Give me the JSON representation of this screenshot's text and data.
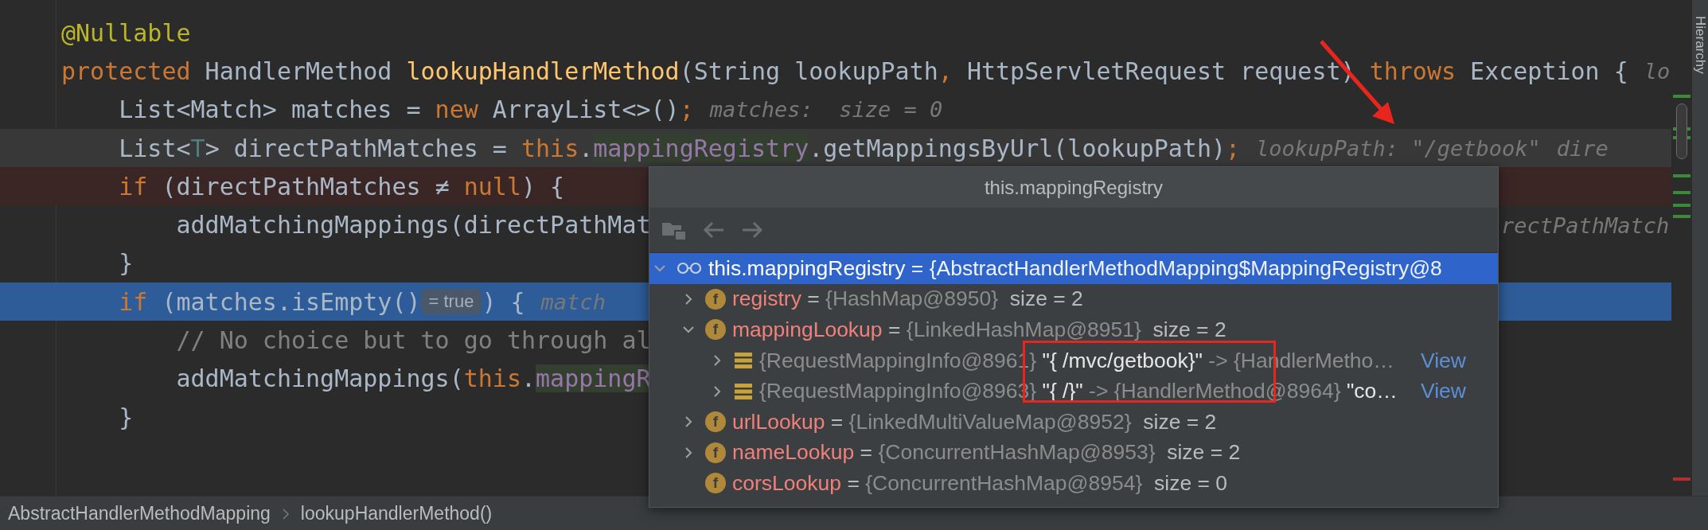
{
  "code_lines": [
    {
      "current_line": false,
      "breakpoint": false,
      "execution_point": false,
      "segments": [
        {
          "text": "@Nullable",
          "kind": "annotation"
        }
      ]
    },
    {
      "current_line": false,
      "breakpoint": false,
      "execution_point": false,
      "segments": [
        {
          "text": "protected",
          "kind": "keyword"
        },
        {
          "text": " HandlerMethod ",
          "kind": "plain"
        },
        {
          "text": "lookupHandlerMethod",
          "kind": "method"
        },
        {
          "text": "(String lookupPath",
          "kind": "plain"
        },
        {
          "text": ",",
          "kind": "keyword"
        },
        {
          "text": " HttpServletRequest request) ",
          "kind": "plain"
        },
        {
          "text": "throws",
          "kind": "keyword"
        },
        {
          "text": " Exception {",
          "kind": "plain"
        },
        {
          "text": "lo",
          "kind": "hint"
        }
      ]
    },
    {
      "current_line": false,
      "breakpoint": false,
      "execution_point": false,
      "segments": [
        {
          "text": "    List<Match> matches = ",
          "kind": "plain"
        },
        {
          "text": "new",
          "kind": "keyword"
        },
        {
          "text": " ArrayList<>()",
          "kind": "plain"
        },
        {
          "text": ";",
          "kind": "keyword"
        },
        {
          "text": "matches:  size = 0",
          "kind": "hint"
        }
      ]
    },
    {
      "current_line": true,
      "breakpoint": false,
      "execution_point": false,
      "segments": [
        {
          "text": "    List<",
          "kind": "plain"
        },
        {
          "text": "T",
          "kind": "type_param"
        },
        {
          "text": "> directPathMatches = ",
          "kind": "plain"
        },
        {
          "text": "this",
          "kind": "keyword"
        },
        {
          "text": ".",
          "kind": "plain"
        },
        {
          "text": "mappingRegistry",
          "kind": "field_usage"
        },
        {
          "text": ".getMappingsByUrl(lookupPath)",
          "kind": "plain"
        },
        {
          "text": ";",
          "kind": "keyword"
        },
        {
          "text": "lookupPath: \"/getbook\"",
          "kind": "hint"
        },
        {
          "text": "dire",
          "kind": "hint"
        }
      ]
    },
    {
      "current_line": false,
      "breakpoint": true,
      "execution_point": false,
      "segments": [
        {
          "text": "    if",
          "kind": "keyword"
        },
        {
          "text": " (directPathMatches ≠ ",
          "kind": "plain"
        },
        {
          "text": "null",
          "kind": "keyword"
        },
        {
          "text": ") {",
          "kind": "plain"
        }
      ]
    },
    {
      "current_line": false,
      "breakpoint": false,
      "execution_point": false,
      "segments": [
        {
          "text": "        addMatchingMappings(directPathMat",
          "kind": "plain"
        },
        {
          "text": "rectPathMatch",
          "kind": "tail_hint"
        }
      ]
    },
    {
      "current_line": false,
      "breakpoint": false,
      "execution_point": false,
      "segments": [
        {
          "text": "    }",
          "kind": "plain"
        }
      ]
    },
    {
      "current_line": false,
      "breakpoint": false,
      "execution_point": true,
      "segments": [
        {
          "text": "    if",
          "kind": "keyword"
        },
        {
          "text": " (matches.isEmpty()",
          "kind": "plain"
        },
        {
          "text": "= true",
          "kind": "badge"
        },
        {
          "text": ") {",
          "kind": "plain"
        },
        {
          "text": "match",
          "kind": "hint"
        }
      ]
    },
    {
      "current_line": false,
      "breakpoint": false,
      "execution_point": false,
      "segments": [
        {
          "text": "        // No choice but to go through al",
          "kind": "comment"
        }
      ]
    },
    {
      "current_line": false,
      "breakpoint": false,
      "execution_point": false,
      "segments": [
        {
          "text": "        addMatchingMappings(",
          "kind": "plain"
        },
        {
          "text": "this",
          "kind": "keyword"
        },
        {
          "text": ".",
          "kind": "plain"
        },
        {
          "text": "mappingR",
          "kind": "field_usage"
        }
      ]
    },
    {
      "current_line": false,
      "breakpoint": false,
      "execution_point": false,
      "segments": [
        {
          "text": "    }",
          "kind": "plain"
        }
      ]
    }
  ],
  "popup": {
    "title": "this.mappingRegistry",
    "toolbar": [
      {
        "kind": "frames",
        "disabled": true
      },
      {
        "kind": "back",
        "disabled": true
      },
      {
        "kind": "forward",
        "disabled": true
      }
    ],
    "tree": [
      {
        "kind": "watch",
        "expanded": true,
        "selected": true,
        "segments": [
          {
            "text": "this.mappingRegistry",
            "kind": "name"
          },
          {
            "text": " = {AbstractHandlerMethodMapping$MappingRegistry@8",
            "kind": "value"
          }
        ],
        "children": [
          {
            "kind": "field",
            "icon_text": "f",
            "expanded": false,
            "selected": false,
            "segments": [
              {
                "text": "registry",
                "kind": "name"
              },
              {
                "text": " = ",
                "kind": "op"
              },
              {
                "text": "{HashMap@8950}",
                "kind": "value"
              },
              {
                "text": "  size = 2",
                "kind": "info"
              }
            ]
          },
          {
            "kind": "field",
            "icon_text": "f",
            "expanded": true,
            "selected": false,
            "segments": [
              {
                "text": "mappingLookup",
                "kind": "name"
              },
              {
                "text": " = ",
                "kind": "op"
              },
              {
                "text": "{LinkedHashMap@8951}",
                "kind": "value"
              },
              {
                "text": "  size = 2",
                "kind": "info"
              }
            ],
            "children": [
              {
                "kind": "entry",
                "expanded": false,
                "selected": false,
                "segments": [
                  {
                    "text": "{RequestMappingInfo@8961}",
                    "kind": "value"
                  },
                  {
                    "text": " \"{ /mvc/getbook}\"",
                    "kind": "string"
                  },
                  {
                    "text": " -> {HandlerMetho…",
                    "kind": "value"
                  },
                  {
                    "text": "View",
                    "kind": "link"
                  }
                ]
              },
              {
                "kind": "entry",
                "expanded": false,
                "selected": false,
                "segments": [
                  {
                    "text": "{RequestMappingInfo@8963}",
                    "kind": "value"
                  },
                  {
                    "text": " \"{ /}\"",
                    "kind": "string"
                  },
                  {
                    "text": " -> {HandlerMethod@8964}",
                    "kind": "value"
                  },
                  {
                    "text": " \"co…",
                    "kind": "string"
                  },
                  {
                    "text": "View",
                    "kind": "link"
                  }
                ]
              }
            ]
          },
          {
            "kind": "field",
            "icon_text": "f",
            "expanded": false,
            "selected": false,
            "segments": [
              {
                "text": "urlLookup",
                "kind": "name"
              },
              {
                "text": " = ",
                "kind": "op"
              },
              {
                "text": "{LinkedMultiValueMap@8952}",
                "kind": "value"
              },
              {
                "text": "  size = 2",
                "kind": "info"
              }
            ]
          },
          {
            "kind": "field",
            "icon_text": "f",
            "expanded": false,
            "selected": false,
            "segments": [
              {
                "text": "nameLookup",
                "kind": "name"
              },
              {
                "text": " = ",
                "kind": "op"
              },
              {
                "text": "{ConcurrentHashMap@8953}",
                "kind": "value"
              },
              {
                "text": "  size = 2",
                "kind": "info"
              }
            ]
          },
          {
            "kind": "field",
            "icon_text": "f",
            "selected": false,
            "segments": [
              {
                "text": "corsLookup",
                "kind": "name"
              },
              {
                "text": " = ",
                "kind": "op"
              },
              {
                "text": "{ConcurrentHashMap@8954}",
                "kind": "value"
              },
              {
                "text": "  size = 0",
                "kind": "info"
              }
            ]
          }
        ]
      }
    ]
  },
  "side_tabs": [
    {
      "label": "Hierarchy"
    }
  ],
  "breadcrumbs": [
    {
      "label": "AbstractHandlerMethodMapping"
    },
    {
      "label": "lookupHandlerMethod()"
    }
  ],
  "annotations": [
    {
      "kind": "arrow"
    },
    {
      "kind": "frame"
    }
  ]
}
